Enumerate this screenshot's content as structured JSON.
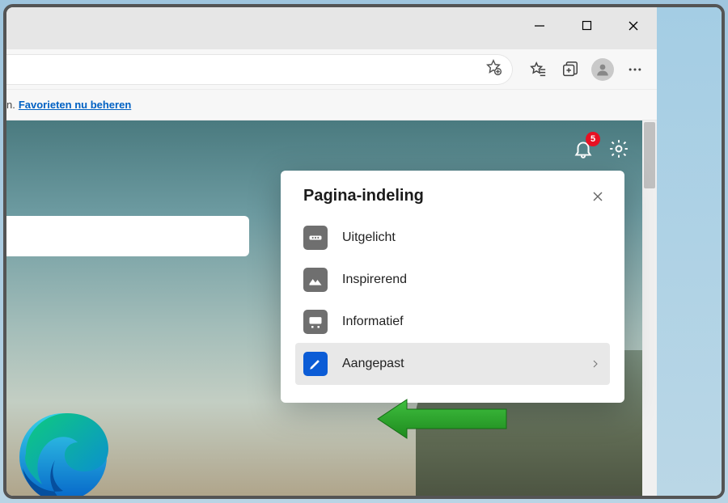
{
  "window": {
    "minimize_name": "minimize",
    "maximize_name": "maximize",
    "close_name": "close"
  },
  "favbar": {
    "suffix": "n.",
    "link": "Favorieten nu beheren"
  },
  "wallpaper": {
    "notification_count": "5"
  },
  "popup": {
    "title": "Pagina-indeling",
    "items": [
      {
        "label": "Uitgelicht"
      },
      {
        "label": "Inspirerend"
      },
      {
        "label": "Informatief"
      },
      {
        "label": "Aangepast"
      }
    ]
  }
}
